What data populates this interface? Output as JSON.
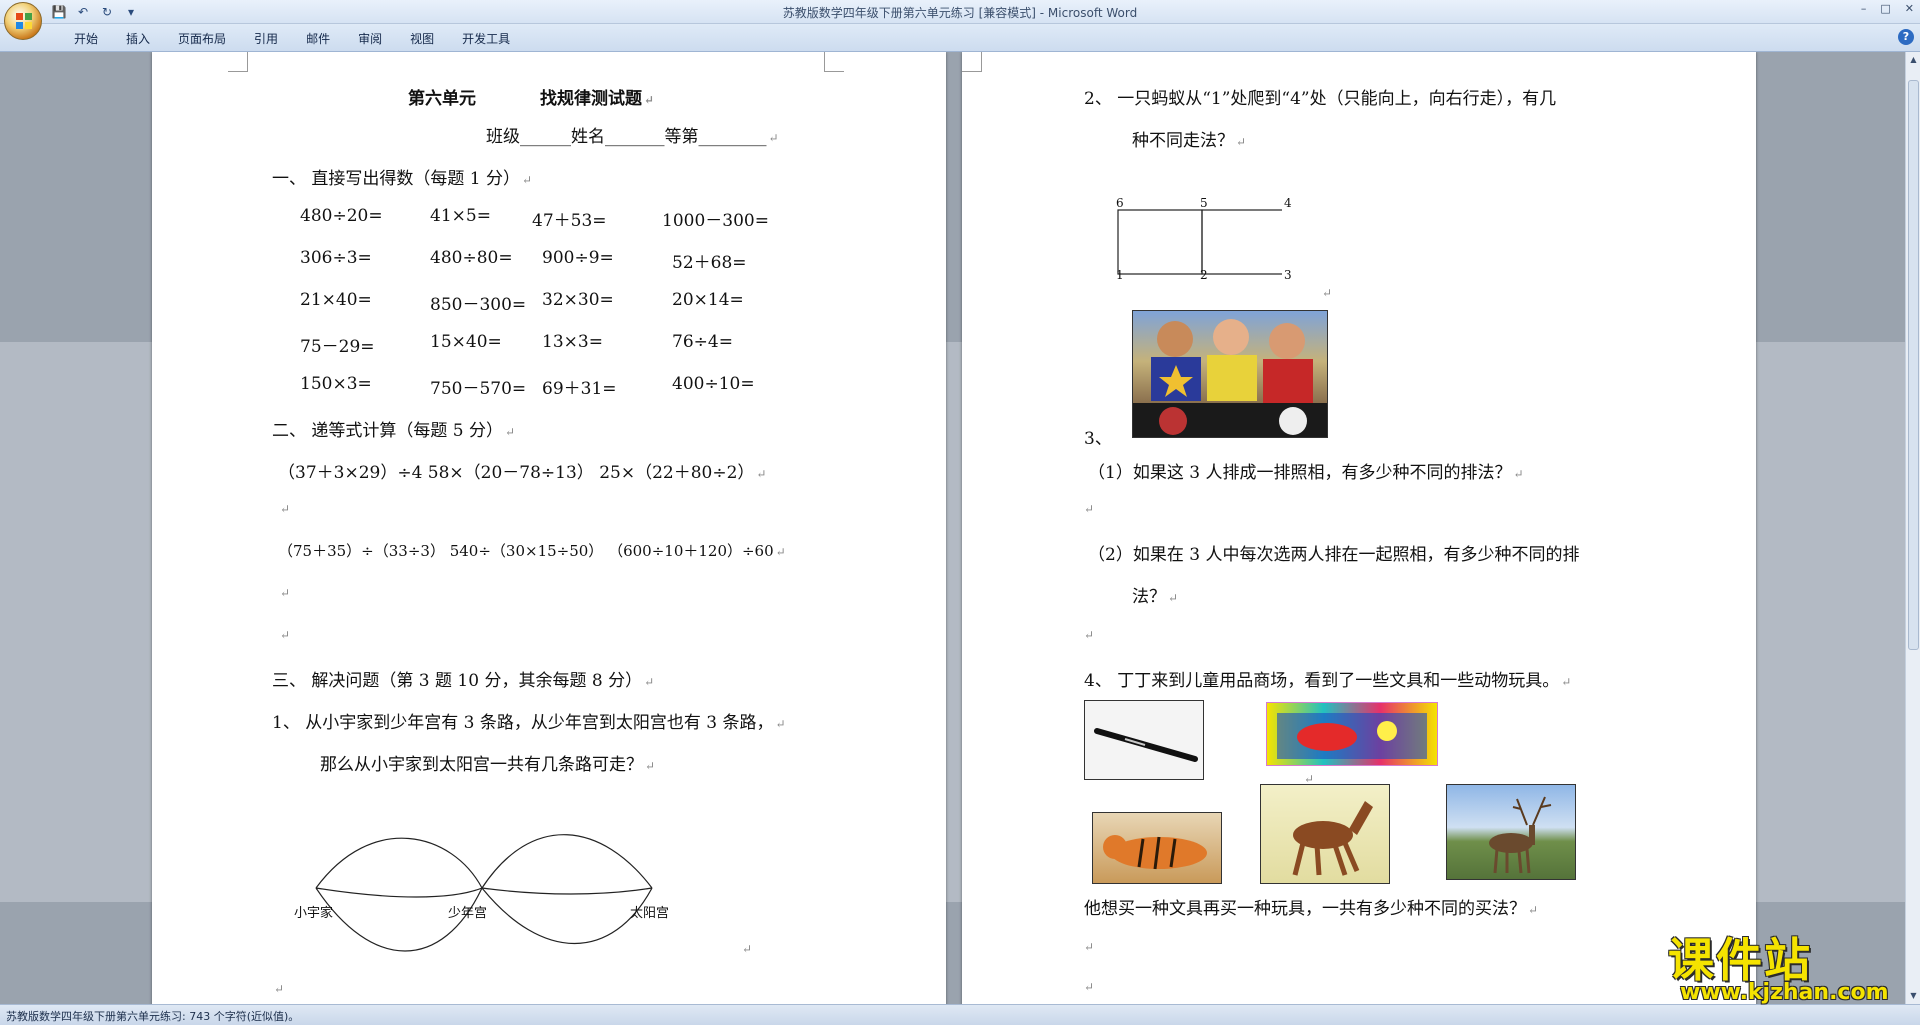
{
  "window": {
    "title": "苏教版数学四年级下册第六单元练习 [兼容模式] - Microsoft Word",
    "controls": [
      "–",
      "□",
      "✕"
    ]
  },
  "ribbon": {
    "tabs": [
      "开始",
      "插入",
      "页面布局",
      "引用",
      "邮件",
      "审阅",
      "视图",
      "开发工具"
    ],
    "help": "?"
  },
  "page1": {
    "title_a": "第六单元",
    "title_b": "找规律测试题",
    "info": "班级______姓名_______等第________",
    "sec1": "一、    直接写出得数（每题 1 分）",
    "calc_rows": [
      [
        "480÷20=",
        "41×5=",
        "47＋53=",
        "1000－300="
      ],
      [
        "306÷3=",
        "480÷80=",
        "900÷9=",
        "52＋68="
      ],
      [
        "21×40=",
        "850－300=",
        "32×30=",
        "20×14="
      ],
      [
        "75－29=",
        "15×40=",
        "13×3=",
        "76÷4="
      ],
      [
        "150×3=",
        "750－570=",
        "69＋31=",
        "400÷10="
      ]
    ],
    "sec2": "二、    递等式计算（每题 5 分）",
    "expr_row1": "（37＋3×29）÷4       58×（20－78÷13）      25×（22＋80÷2）",
    "expr_row2": "（75＋35）÷（33÷3）   540÷（30×15÷50）   （600÷10＋120）÷60",
    "sec3": "三、    解决问题（第 3 题 10 分，其余每题 8 分）",
    "q1_line1": "1、    从小宇家到少年宫有 3 条路，从少年宫到太阳宫也有 3 条路，",
    "q1_line2": "那么从小宇家到太阳宫一共有几条路可走？",
    "map_labels": [
      "小宇家",
      "少年宫",
      "太阳宫"
    ]
  },
  "page2": {
    "q2_line1": "2、    一只蚂蚁从“1”处爬到“4”处（只能向上，向右行走），有几",
    "q2_line2": "种不同走法？",
    "grid_labels": [
      "6",
      "5",
      "4",
      "1",
      "2",
      "3"
    ],
    "q3": "3、",
    "q3_1": "（1）如果这 3 人排成一排照相，有多少种不同的排法？",
    "q3_2_line1": "（2）如果在  3  人中每次选两人排在一起照相，有多少种不同的排",
    "q3_2_line2": "法？",
    "q4": "4、    丁丁来到儿童用品商场，看到了一些文具和一些动物玩具。",
    "q4_question": "他想买一种文具再买一种玩具，一共有多少种不同的买法？"
  },
  "paragraph_mark": "↵",
  "status": {
    "text": "苏教版数学四年级下册第六单元练习: 743 个字符(近似值)。"
  },
  "watermark": {
    "big": "课件站",
    "small": "www.kjzhan.com"
  },
  "colors": {
    "watermark": "#f5e300",
    "ribbon": "#dfeaf7"
  }
}
